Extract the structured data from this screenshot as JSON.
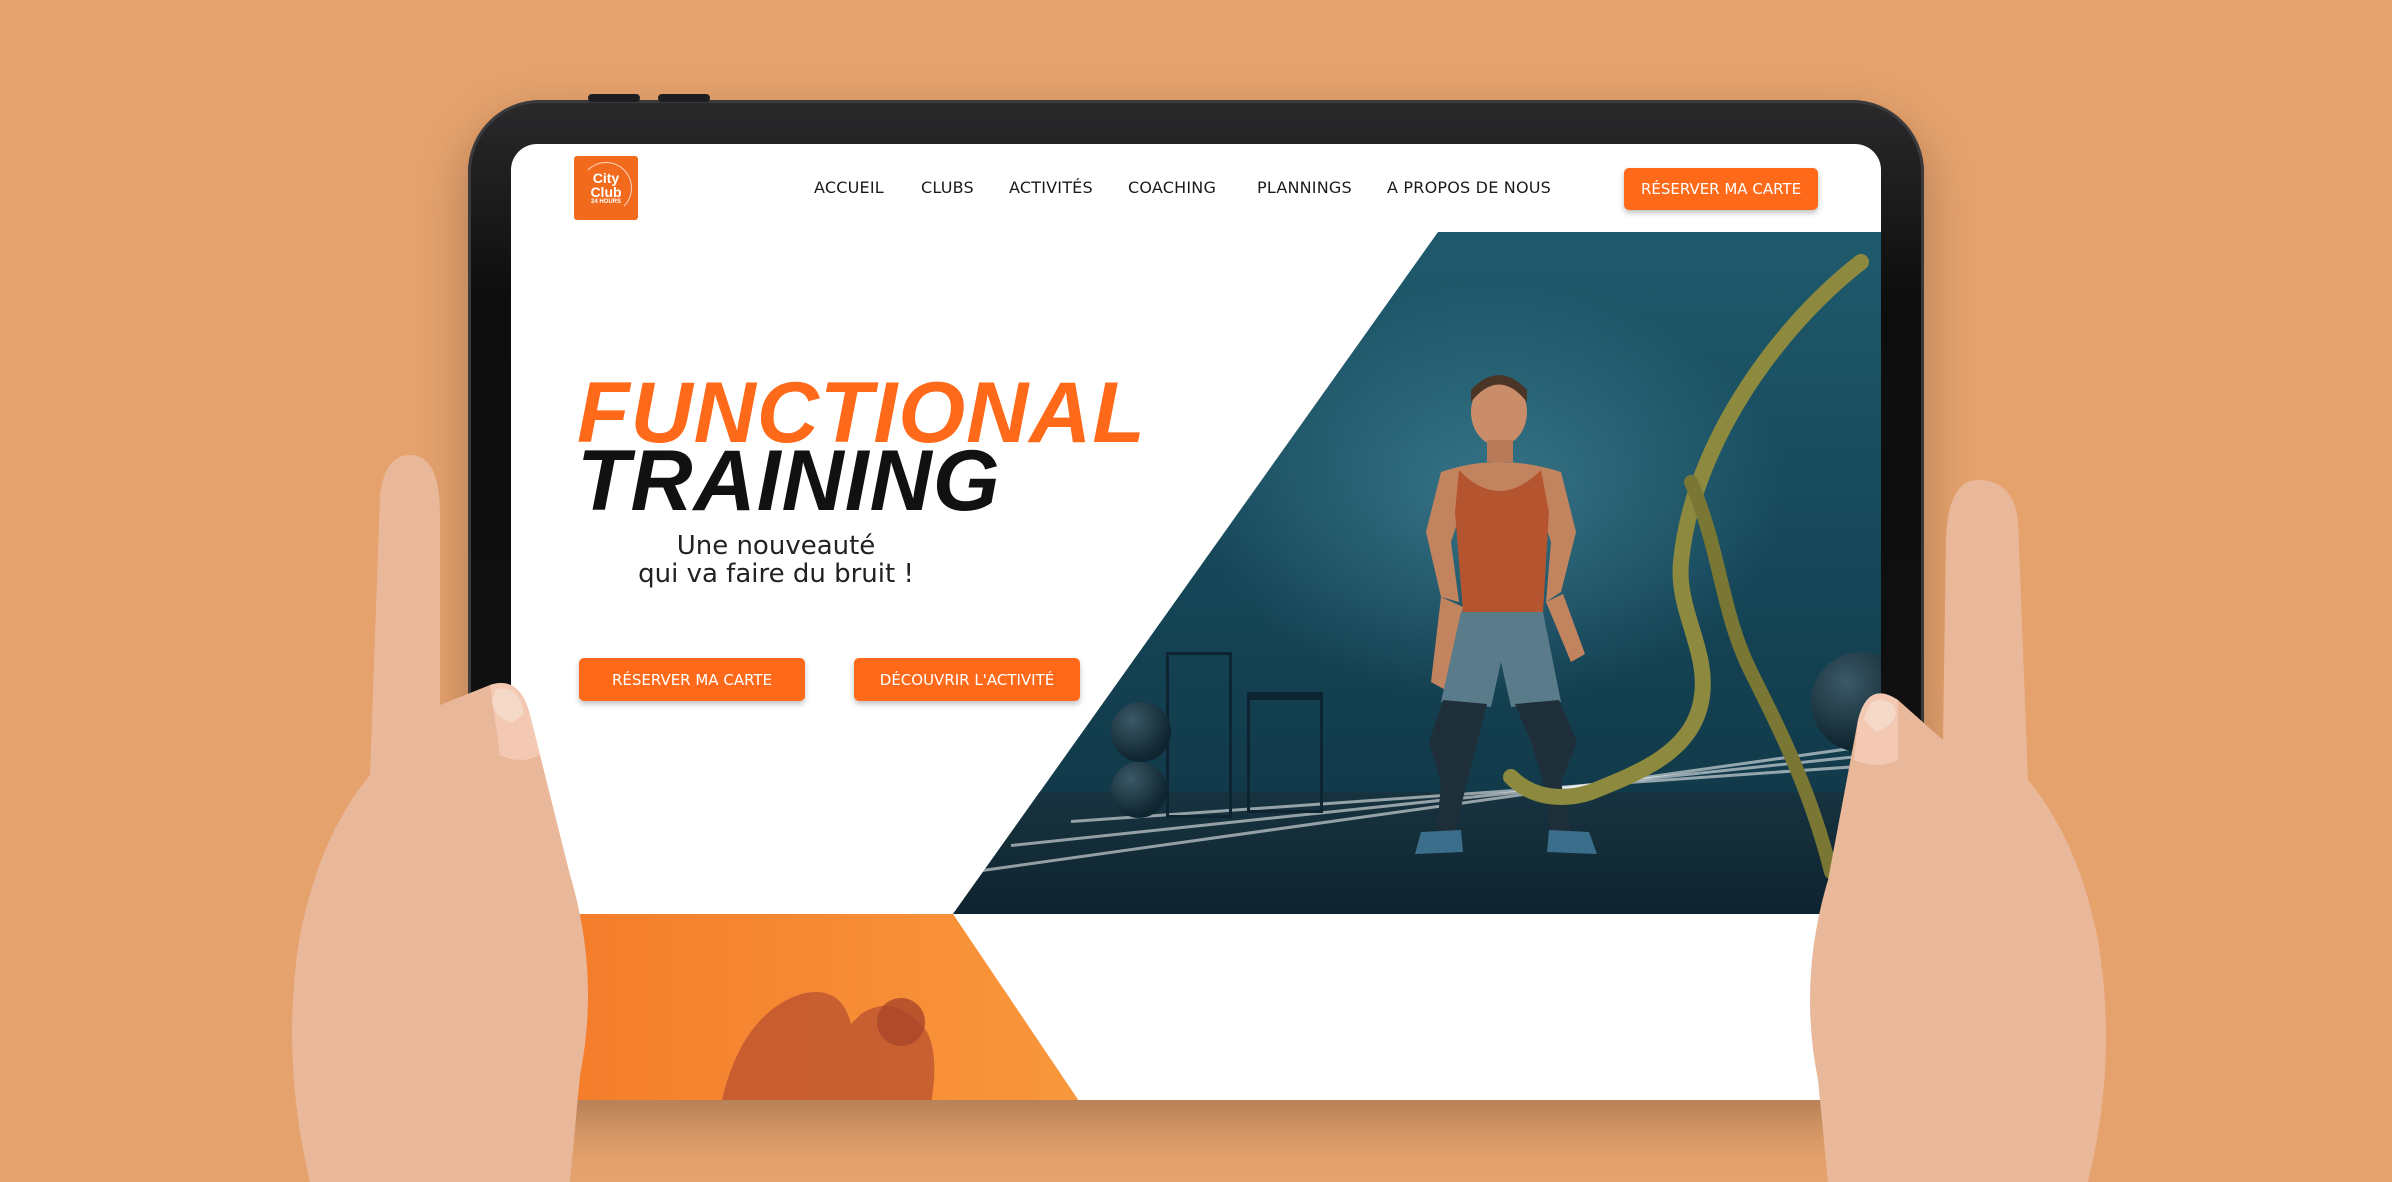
{
  "brand": {
    "logo_line1": "City",
    "logo_line2": "Club",
    "logo_line3": "24 HOURS",
    "accent_color": "#ff6a1a",
    "background_color": "#e5a26d"
  },
  "nav": {
    "items": [
      {
        "label": "ACCUEIL"
      },
      {
        "label": "CLUBS"
      },
      {
        "label": "ACTIVITÉS"
      },
      {
        "label": "COACHING"
      },
      {
        "label": "PLANNINGS"
      },
      {
        "label": "A PROPOS DE NOUS"
      }
    ],
    "cta_label": "RÉSERVER MA CARTE"
  },
  "hero": {
    "title_line1": "FUNCTIONAL",
    "title_line2": "TRAINING",
    "subtitle_line1": "Une nouveauté",
    "subtitle_line2": "qui va faire du bruit !",
    "primary_button": "RÉSERVER MA CARTE",
    "secondary_button": "DÉCOUVRIR L'ACTIVITÉ",
    "image_icon": "battle-ropes-athlete-photo"
  },
  "lower_section": {
    "image_icon": "stretching-woman-photo"
  }
}
